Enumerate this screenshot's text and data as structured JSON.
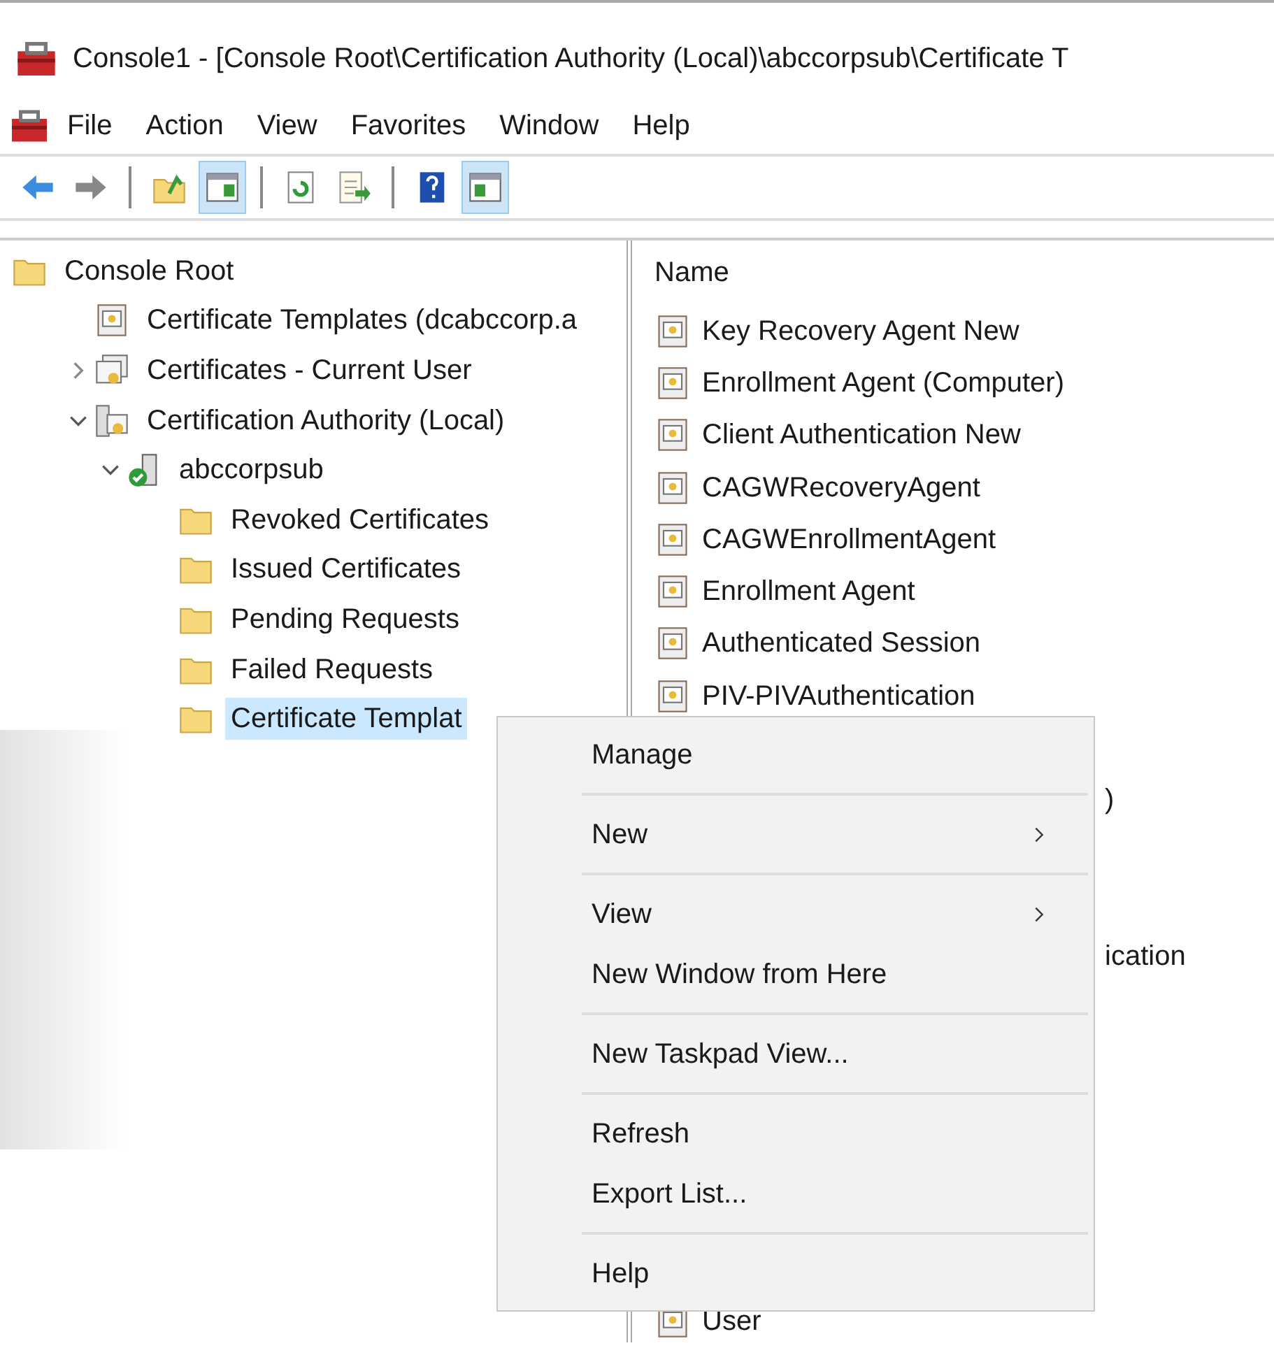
{
  "window": {
    "title": "Console1 - [Console Root\\Certification Authority (Local)\\abccorpsub\\Certificate T"
  },
  "menu_bar": [
    "File",
    "Action",
    "View",
    "Favorites",
    "Window",
    "Help"
  ],
  "toolbar": [
    {
      "kind": "back",
      "pressed": false
    },
    {
      "kind": "forward",
      "pressed": false
    },
    {
      "kind": "separator"
    },
    {
      "kind": "up",
      "pressed": false
    },
    {
      "kind": "tree-pane",
      "pressed": true
    },
    {
      "kind": "separator"
    },
    {
      "kind": "refresh",
      "pressed": false
    },
    {
      "kind": "export",
      "pressed": false
    },
    {
      "kind": "separator"
    },
    {
      "kind": "help",
      "pressed": false
    },
    {
      "kind": "action-pane",
      "pressed": true
    }
  ],
  "tree": [
    {
      "label": "Console Root",
      "kind": "folder",
      "selected": false,
      "children": [
        {
          "label": "Certificate Templates (dcabccorp.a",
          "kind": "template",
          "selected": false
        },
        {
          "label": "Certificates - Current User",
          "kind": "certs",
          "selected": false,
          "expanded": false
        },
        {
          "label": "Certification Authority (Local)",
          "kind": "ca",
          "selected": false,
          "expanded": true,
          "children": [
            {
              "label": "abccorpsub",
              "kind": "server",
              "selected": false,
              "expanded": true,
              "children": [
                {
                  "label": "Revoked Certificates",
                  "kind": "folder",
                  "selected": false
                },
                {
                  "label": "Issued Certificates",
                  "kind": "folder",
                  "selected": false
                },
                {
                  "label": "Pending Requests",
                  "kind": "folder",
                  "selected": false
                },
                {
                  "label": "Failed Requests",
                  "kind": "folder",
                  "selected": false
                },
                {
                  "label": "Certificate Templat",
                  "kind": "folder",
                  "selected": true
                }
              ]
            }
          ]
        }
      ]
    }
  ],
  "list": {
    "column": "Name",
    "rows": [
      {
        "kind": "item",
        "text": "Key Recovery Agent New"
      },
      {
        "kind": "item",
        "text": "Enrollment Agent (Computer)"
      },
      {
        "kind": "item",
        "text": "Client Authentication New"
      },
      {
        "kind": "item",
        "text": "CAGWRecoveryAgent"
      },
      {
        "kind": "item",
        "text": "CAGWEnrollmentAgent"
      },
      {
        "kind": "item",
        "text": "Enrollment Agent"
      },
      {
        "kind": "item",
        "text": "Authenticated Session"
      },
      {
        "kind": "item",
        "text": "PIV-PIVAuthentication"
      },
      {
        "kind": "covered"
      },
      {
        "kind": "fragment",
        "text": ")"
      },
      {
        "kind": "covered"
      },
      {
        "kind": "covered"
      },
      {
        "kind": "fragment",
        "text": "ication"
      },
      {
        "kind": "covered"
      },
      {
        "kind": "covered"
      },
      {
        "kind": "covered"
      },
      {
        "kind": "covered"
      },
      {
        "kind": "covered"
      },
      {
        "kind": "covered"
      },
      {
        "kind": "item",
        "text": "User"
      }
    ]
  },
  "context_menu": [
    {
      "kind": "item",
      "label": "Manage",
      "submenu": false
    },
    {
      "kind": "separator"
    },
    {
      "kind": "item",
      "label": "New",
      "submenu": true
    },
    {
      "kind": "separator"
    },
    {
      "kind": "item",
      "label": "View",
      "submenu": true
    },
    {
      "kind": "item",
      "label": "New Window from Here",
      "submenu": false
    },
    {
      "kind": "separator"
    },
    {
      "kind": "item",
      "label": "New Taskpad View...",
      "submenu": false
    },
    {
      "kind": "separator"
    },
    {
      "kind": "item",
      "label": "Refresh",
      "submenu": false
    },
    {
      "kind": "item",
      "label": "Export List...",
      "submenu": false
    },
    {
      "kind": "separator"
    },
    {
      "kind": "item",
      "label": "Help",
      "submenu": false
    }
  ]
}
